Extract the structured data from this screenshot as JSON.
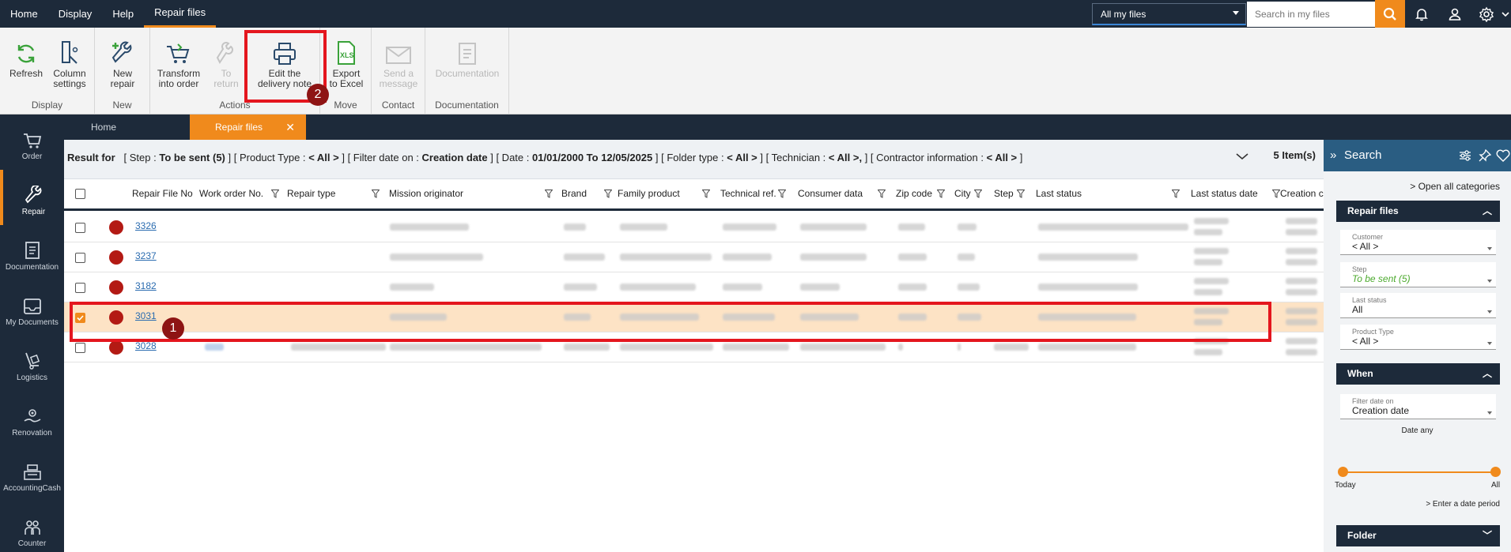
{
  "menu": {
    "items": [
      {
        "label": "Home"
      },
      {
        "label": "Display"
      },
      {
        "label": "Help"
      },
      {
        "label": "Repair files",
        "active": true
      }
    ]
  },
  "top": {
    "files_select": "All my files",
    "search_placeholder": "Search in my files"
  },
  "ribbon": {
    "groups": [
      {
        "name": "Display"
      },
      {
        "name": "New"
      },
      {
        "name": "Actions"
      },
      {
        "name": "Move"
      },
      {
        "name": "Contact"
      },
      {
        "name": "Documentation"
      }
    ],
    "buttons": [
      {
        "line1": "Refresh",
        "line2": ""
      },
      {
        "line1": "Column",
        "line2": "settings"
      },
      {
        "line1": "New",
        "line2": "repair"
      },
      {
        "line1": "Transform",
        "line2": "into order"
      },
      {
        "line1": "To",
        "line2": "return"
      },
      {
        "line1": "Edit the",
        "line2": "delivery note"
      },
      {
        "line1": "Export",
        "line2": "to Excel"
      },
      {
        "line1": "Send a",
        "line2": "message"
      },
      {
        "line1": "Documentation",
        "line2": ""
      }
    ]
  },
  "nav": [
    {
      "label": "Order"
    },
    {
      "label": "Repair"
    },
    {
      "label": "Documentation"
    },
    {
      "label": "My Documents"
    },
    {
      "label": "Logistics"
    },
    {
      "label": "Renovation"
    },
    {
      "label": "AccountingCash"
    },
    {
      "label": "Counter"
    }
  ],
  "tabs": [
    {
      "label": "Home"
    },
    {
      "label": "Repair files"
    }
  ],
  "filter": {
    "prefix": "Result for",
    "step_label": "[ Step :",
    "step_value": "To be sent (5)",
    "product_label": "]  [ Product Type :",
    "product_value": "< All >",
    "filterdate_label": "]  [ Filter date on :",
    "filterdate_value": "Creation date",
    "date_label": "]  [ Date :",
    "date_value": "01/01/2000 To 12/05/2025",
    "folder_label": "]  [ Folder type :",
    "folder_value": "< All >",
    "tech_label": "]  [ Technician :",
    "tech_value": "< All >,",
    "contractor_label": "]  [ Contractor information :",
    "contractor_value": "< All >",
    "end": "]",
    "count": "5 Item(s)"
  },
  "columns": {
    "repair_file_no": "Repair File No",
    "work_order": "Work order No.",
    "repair_type": "Repair type",
    "mission": "Mission originator",
    "brand": "Brand",
    "family": "Family product",
    "techref": "Technical ref.",
    "consumer": "Consumer data",
    "zip": "Zip code",
    "city": "City",
    "step": "Step",
    "last_status": "Last status",
    "last_status_date": "Last status date",
    "creation": "Creation c"
  },
  "rows": [
    {
      "file_no": "3326",
      "selected": false
    },
    {
      "file_no": "3237",
      "selected": false
    },
    {
      "file_no": "3182",
      "selected": false
    },
    {
      "file_no": "3031",
      "selected": true
    },
    {
      "file_no": "3028",
      "selected": false
    }
  ],
  "annotations": {
    "badge1": "1",
    "badge2": "2"
  },
  "panel": {
    "title": "Search",
    "open_all": "Open all categories",
    "section_repair": "Repair files",
    "customer_label": "Customer",
    "customer_value": "< All >",
    "step_label": "Step",
    "step_value": "To be sent (5)",
    "last_status_label": "Last status",
    "last_status_value": "All",
    "product_type_label": "Product Type",
    "product_type_value": "< All >",
    "section_when": "When",
    "filter_date_label": "Filter date on",
    "filter_date_value": "Creation date",
    "date_any": "Date any",
    "slider_left": "Today",
    "slider_right": "All",
    "enter_period": "> Enter a date period",
    "section_folder": "Folder"
  },
  "colors": {
    "navy": "#1d2a3a",
    "accent_orange": "#f08a1c",
    "highlight_red": "#e4161e",
    "status_red": "#b31a14",
    "selected_row": "#fde3c5"
  }
}
